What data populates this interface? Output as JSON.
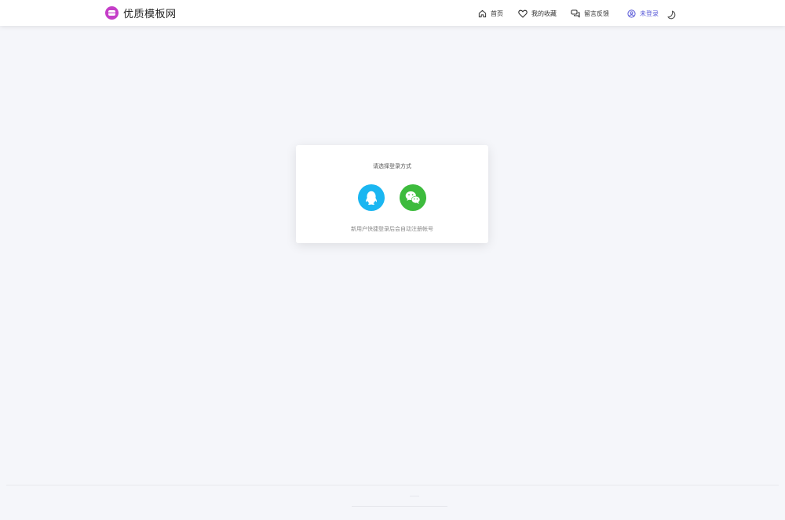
{
  "header": {
    "brand_name": "优质模板网",
    "logo_icon": "smiley-logo-icon",
    "nav": [
      {
        "label": "首页",
        "icon": "home-icon"
      },
      {
        "label": "我的收藏",
        "icon": "heart-icon"
      },
      {
        "label": "留言反馈",
        "icon": "chat-bubbles-icon"
      },
      {
        "label": "未登录",
        "icon": "user-circle-icon"
      }
    ],
    "theme_icon": "moon-icon"
  },
  "login": {
    "title": "请选择登录方式",
    "options": [
      {
        "name": "QQ",
        "icon": "qq-penguin-icon",
        "color": "#1ab6f1"
      },
      {
        "name": "WeChat",
        "icon": "wechat-icon",
        "color": "#3dbb3d"
      }
    ],
    "note": "新用户快捷登录后会自动注册帐号"
  },
  "colors": {
    "accent": "#5a5bd8",
    "brand": "#c53ec8",
    "background": "#f5f6fa"
  }
}
